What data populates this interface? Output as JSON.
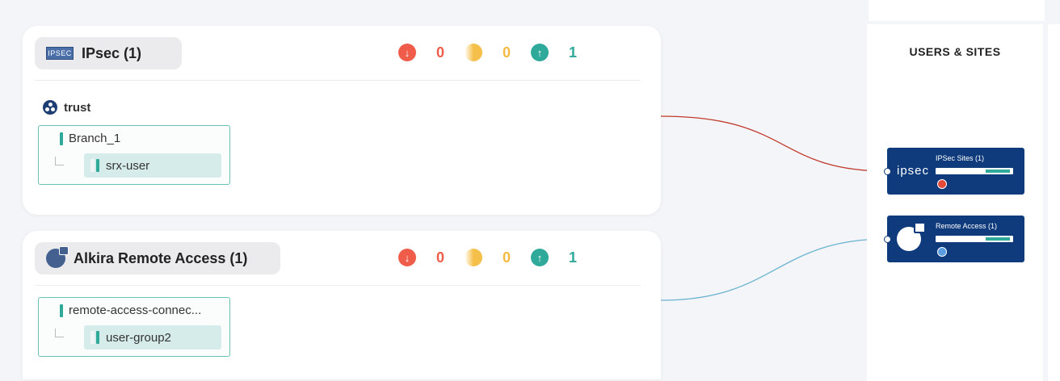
{
  "groups": [
    {
      "title": "IPsec (1)",
      "logo_text": "IPSEC",
      "counters": {
        "down": "0",
        "degraded": "0",
        "up": "1"
      },
      "segment": "trust",
      "connector": "Branch_1",
      "child": "srx-user"
    },
    {
      "title": "Alkira Remote Access (1)",
      "counters": {
        "down": "0",
        "degraded": "0",
        "up": "1"
      },
      "connector": "remote-access-connec...",
      "child": "user-group2"
    }
  ],
  "panel": {
    "title": "USERS & SITES",
    "sites": [
      {
        "name": "IPSec Sites (1)",
        "logo_text": "ipsec",
        "status_color": "#e34a3a",
        "link_color": "#c0392b"
      },
      {
        "name": "Remote Access (1)",
        "status_color": "#5a9de0",
        "link_color": "#6ab4d0"
      }
    ]
  },
  "colors": {
    "down": "#ef5d4a",
    "degraded": "#f5c04a",
    "up": "#2fa99a",
    "site_bg": "#0f3b7d"
  }
}
